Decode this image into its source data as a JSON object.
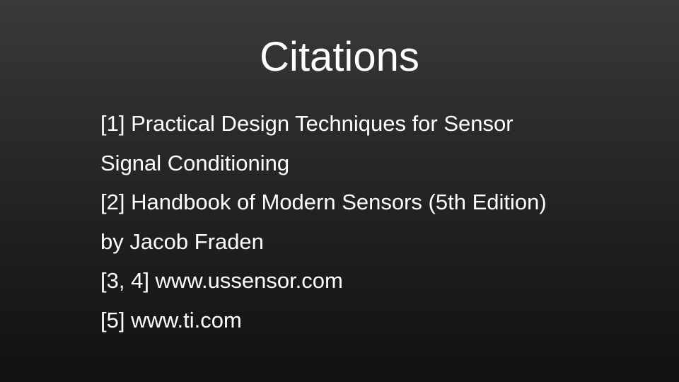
{
  "slide": {
    "title": "Citations",
    "lines": [
      "[1] Practical Design Techniques for Sensor",
      "Signal Conditioning",
      "[2] Handbook of Modern Sensors (5th Edition)",
      "by Jacob Fraden",
      "[3, 4] www.ussensor.com",
      "[5] www.ti.com"
    ]
  },
  "colors": {
    "background_top": "#3a3a3a",
    "background_bottom": "#111111",
    "text": "#ffffff"
  }
}
